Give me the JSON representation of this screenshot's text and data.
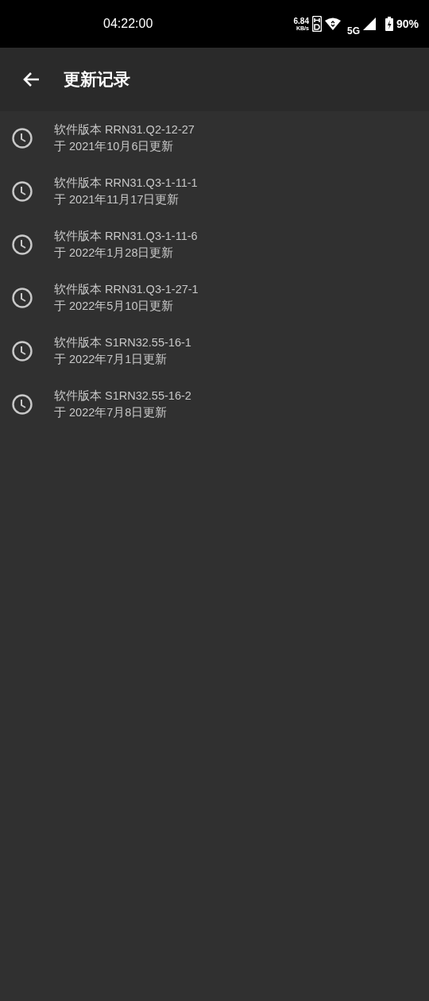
{
  "status_bar": {
    "time": "04:22:00",
    "net_speed": "6.84",
    "net_unit": "KB/s",
    "network": "5G",
    "battery": "90%"
  },
  "toolbar": {
    "title": "更新记录"
  },
  "updates": [
    {
      "version": "软件版本 RRN31.Q2-12-27",
      "date": "于 2021年10月6日更新"
    },
    {
      "version": "软件版本 RRN31.Q3-1-11-1",
      "date": "于 2021年11月17日更新"
    },
    {
      "version": "软件版本 RRN31.Q3-1-11-6",
      "date": "于 2022年1月28日更新"
    },
    {
      "version": "软件版本 RRN31.Q3-1-27-1",
      "date": "于 2022年5月10日更新"
    },
    {
      "version": "软件版本 S1RN32.55-16-1",
      "date": "于 2022年7月1日更新"
    },
    {
      "version": "软件版本 S1RN32.55-16-2",
      "date": "于 2022年7月8日更新"
    }
  ]
}
